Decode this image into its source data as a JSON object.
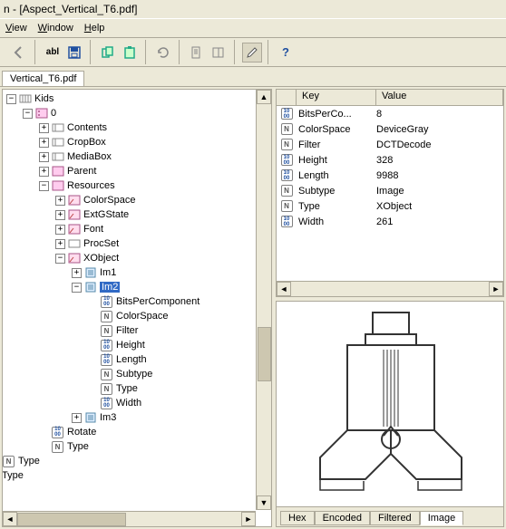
{
  "title": "n - [Aspect_Vertical_T6.pdf]",
  "menu": {
    "view": "View",
    "window": "Window",
    "help": "Help"
  },
  "toolbar": {
    "abl": "abl",
    "qmark": "?"
  },
  "tab": {
    "label": "Vertical_T6.pdf"
  },
  "tree": {
    "kids": "Kids",
    "zero": "0",
    "contents": "Contents",
    "cropbox": "CropBox",
    "mediabox": "MediaBox",
    "parent": "Parent",
    "resources": "Resources",
    "colorspace": "ColorSpace",
    "extgstate": "ExtGState",
    "font": "Font",
    "procset": "ProcSet",
    "xobject": "XObject",
    "im1": "Im1",
    "im2": "Im2",
    "bpc": "BitsPerComponent",
    "cs": "ColorSpace",
    "filter": "Filter",
    "height": "Height",
    "length": "Length",
    "subtype": "Subtype",
    "ttype": "Type",
    "width": "Width",
    "im3": "Im3",
    "rotate": "Rotate",
    "ntype": "Type",
    "btype": "Type",
    "btype2": "Type"
  },
  "props": {
    "header_key": "Key",
    "header_val": "Value",
    "rows": [
      {
        "icon": "num",
        "key": "BitsPerCo...",
        "val": "8"
      },
      {
        "icon": "n",
        "key": "ColorSpace",
        "val": "DeviceGray"
      },
      {
        "icon": "n",
        "key": "Filter",
        "val": "DCTDecode"
      },
      {
        "icon": "num",
        "key": "Height",
        "val": "328"
      },
      {
        "icon": "num",
        "key": "Length",
        "val": "9988"
      },
      {
        "icon": "n",
        "key": "Subtype",
        "val": "Image"
      },
      {
        "icon": "n",
        "key": "Type",
        "val": "XObject"
      },
      {
        "icon": "num",
        "key": "Width",
        "val": "261"
      }
    ]
  },
  "preview_tabs": {
    "hex": "Hex",
    "encoded": "Encoded",
    "filtered": "Filtered",
    "image": "Image"
  }
}
